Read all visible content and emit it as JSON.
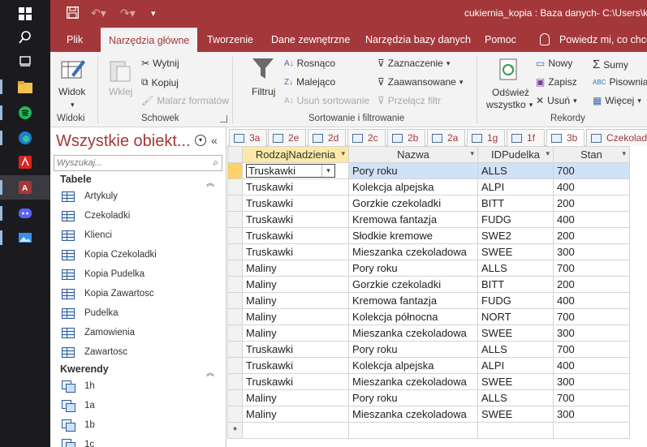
{
  "app": {
    "title": "cukiernia_kopia : Baza danych- C:\\Users\\kc",
    "accent": "#a4373a"
  },
  "quick_access": {
    "undo_icon": "undo-icon",
    "redo_icon": "redo-icon",
    "save_icon": "save-icon"
  },
  "ribbon_tabs": [
    {
      "label": "Plik"
    },
    {
      "label": "Narzędzia główne"
    },
    {
      "label": "Tworzenie"
    },
    {
      "label": "Dane zewnętrzne"
    },
    {
      "label": "Narzędzia bazy danych"
    },
    {
      "label": "Pomoc"
    },
    {
      "label": "Powiedz mi, co chce"
    }
  ],
  "ribbon": {
    "widok": "Widok",
    "widoki": "Widoki",
    "wklej": "Wklej",
    "wytnij": "Wytnij",
    "kopiuj": "Kopiuj",
    "malarz": "Malarz formatów",
    "schowek": "Schowek",
    "filtruj": "Filtruj",
    "rosnaco": "Rosnąco",
    "malejaco": "Malejąco",
    "usun_sort": "Usuń sortowanie",
    "zaznaczenie": "Zaznaczenie",
    "zaawansowane": "Zaawansowane",
    "przelacz": "Przełącz filtr",
    "sort_group": "Sortowanie i filtrowanie",
    "odswiez": "Odśwież",
    "wszystko": "wszystko",
    "nowy": "Nowy",
    "zapisz": "Zapisz",
    "usun": "Usuń",
    "sumy": "Sumy",
    "pisownia": "Pisownia",
    "wiecej": "Więcej",
    "rekordy": "Rekordy"
  },
  "nav": {
    "title": "Wszystkie obiekt...",
    "search_placeholder": "Wyszukaj...",
    "tables_header": "Tabele",
    "tables": [
      "Artykuly",
      "Czekoladki",
      "Klienci",
      "Kopia Czekoladki",
      "Kopia Pudelka",
      "Kopia Zawartosc",
      "Pudelka",
      "Zamowienia",
      "Zawartosc"
    ],
    "queries_header": "Kwerendy",
    "queries": [
      "1h",
      "1a",
      "1b",
      "1c"
    ]
  },
  "object_tabs": [
    "3a",
    "2e",
    "2d",
    "2c",
    "2b",
    "2a",
    "1g",
    "1f",
    "3b",
    "Czekolad"
  ],
  "grid": {
    "columns": [
      "RodzajNadzienia",
      "Nazwa",
      "IDPudelka",
      "Stan"
    ],
    "new_row_marker": "*",
    "rows": [
      [
        "Truskawki",
        "Pory roku",
        "ALLS",
        "700"
      ],
      [
        "Truskawki",
        "Kolekcja alpejska",
        "ALPI",
        "400"
      ],
      [
        "Truskawki",
        "Gorzkie czekoladki",
        "BITT",
        "200"
      ],
      [
        "Truskawki",
        "Kremowa fantazja",
        "FUDG",
        "400"
      ],
      [
        "Truskawki",
        "Słodkie kremowe",
        "SWE2",
        "200"
      ],
      [
        "Truskawki",
        "Mieszanka czekoladowa",
        "SWEE",
        "300"
      ],
      [
        "Maliny",
        "Pory roku",
        "ALLS",
        "700"
      ],
      [
        "Maliny",
        "Gorzkie czekoladki",
        "BITT",
        "200"
      ],
      [
        "Maliny",
        "Kremowa fantazja",
        "FUDG",
        "400"
      ],
      [
        "Maliny",
        "Kolekcja północna",
        "NORT",
        "700"
      ],
      [
        "Maliny",
        "Mieszanka czekoladowa",
        "SWEE",
        "300"
      ],
      [
        "Truskawki",
        "Pory roku",
        "ALLS",
        "700"
      ],
      [
        "Truskawki",
        "Kolekcja alpejska",
        "ALPI",
        "400"
      ],
      [
        "Truskawki",
        "Mieszanka czekoladowa",
        "SWEE",
        "300"
      ],
      [
        "Maliny",
        "Pory roku",
        "ALLS",
        "700"
      ],
      [
        "Maliny",
        "Mieszanka czekoladowa",
        "SWEE",
        "300"
      ]
    ]
  }
}
